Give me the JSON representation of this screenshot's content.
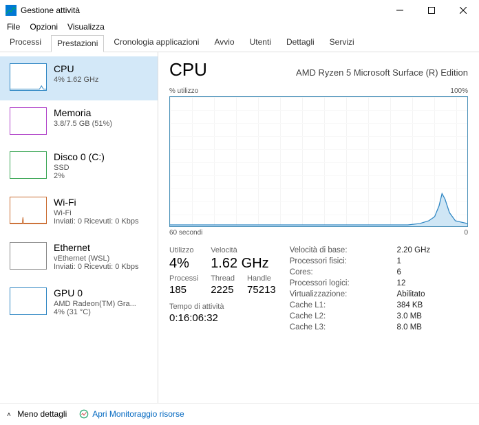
{
  "window": {
    "title": "Gestione attività"
  },
  "menubar": [
    "File",
    "Opzioni",
    "Visualizza"
  ],
  "tabs": {
    "items": [
      "Processi",
      "Prestazioni",
      "Cronologia applicazioni",
      "Avvio",
      "Utenti",
      "Dettagli",
      "Servizi"
    ],
    "active_index": 1
  },
  "sidebar": [
    {
      "name": "CPU",
      "sub": "4%  1.62 GHz",
      "color": "#2f86c3",
      "active": true
    },
    {
      "name": "Memoria",
      "sub": "3.8/7.5 GB (51%)",
      "color": "#b144c9"
    },
    {
      "name": "Disco 0 (C:)",
      "sub": "SSD\n2%",
      "color": "#3aa655"
    },
    {
      "name": "Wi-Fi",
      "sub": "Wi-Fi\nInviati: 0  Ricevuti: 0 Kbps",
      "color": "#c96a2e"
    },
    {
      "name": "Ethernet",
      "sub": "vEthernet (WSL)\nInviati: 0  Ricevuti: 0 Kbps",
      "color": "#888"
    },
    {
      "name": "GPU 0",
      "sub": "AMD Radeon(TM) Gra...\n4% (31 °C)",
      "color": "#2f86c3"
    }
  ],
  "main": {
    "title": "CPU",
    "subtitle": "AMD Ryzen 5 Microsoft Surface (R) Edition",
    "chart_top_left": "% utilizzo",
    "chart_top_right": "100%",
    "chart_bottom_left": "60 secondi",
    "chart_bottom_right": "0",
    "stats_left": {
      "utilizzo_label": "Utilizzo",
      "utilizzo_value": "4%",
      "velocita_label": "Velocità",
      "velocita_value": "1.62 GHz",
      "processi_label": "Processi",
      "processi_value": "185",
      "thread_label": "Thread",
      "thread_value": "2225",
      "handle_label": "Handle",
      "handle_value": "75213",
      "uptime_label": "Tempo di attività",
      "uptime_value": "0:16:06:32"
    },
    "stats_right": [
      [
        "Velocità di base:",
        "2.20 GHz"
      ],
      [
        "Processori fisici:",
        "1"
      ],
      [
        "Cores:",
        "6"
      ],
      [
        "Processori logici:",
        "12"
      ],
      [
        "Virtualizzazione:",
        "Abilitato"
      ],
      [
        "Cache L1:",
        "384 KB"
      ],
      [
        "Cache L2:",
        "3.0 MB"
      ],
      [
        "Cache L3:",
        "8.0 MB"
      ]
    ]
  },
  "footer": {
    "fewer_details": "Meno dettagli",
    "resource_monitor": "Apri Monitoraggio risorse"
  },
  "chart_data": {
    "type": "line",
    "title": "% utilizzo",
    "xlabel": "60 secondi",
    "ylabel": "",
    "xlim": [
      60,
      0
    ],
    "ylim": [
      0,
      100
    ],
    "x": [
      60,
      55,
      50,
      45,
      40,
      35,
      30,
      25,
      20,
      15,
      12,
      10,
      8,
      6,
      5,
      4,
      3,
      2,
      1,
      0
    ],
    "values": [
      1,
      1,
      2,
      1,
      1,
      2,
      1,
      2,
      1,
      2,
      3,
      4,
      6,
      10,
      18,
      25,
      14,
      7,
      4,
      3
    ]
  }
}
